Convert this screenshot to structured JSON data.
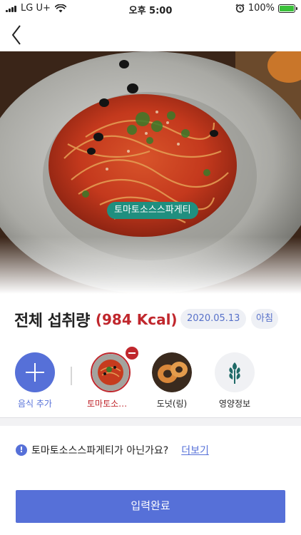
{
  "status_bar": {
    "carrier": "LG U+",
    "time": "오후 5:00",
    "battery_percent": "100%",
    "battery_level": 1.0
  },
  "photo": {
    "food_tag": "토마토소스스파게티"
  },
  "summary": {
    "title": "전체 섭취량",
    "kcal": "(984 Kcal)",
    "date": "2020.05.13",
    "meal": "아침"
  },
  "foods": {
    "add_label": "음식 추가",
    "items": [
      {
        "label": "토마토소스스파게티",
        "selected": true
      },
      {
        "label": "도넛(링)",
        "selected": false
      }
    ],
    "nutrition_label": "영양정보"
  },
  "notice": {
    "prefix_food": "토마토소스스파게티",
    "question": "가 아닌가요?",
    "more_link": "더보기",
    "icon": "exclamation-icon"
  },
  "submit": {
    "label": "입력완료"
  },
  "colors": {
    "primary": "#5670d8",
    "accent_red": "#c0272d",
    "tag_teal": "#1f8f7f",
    "chip_bg": "#eef0f5"
  }
}
